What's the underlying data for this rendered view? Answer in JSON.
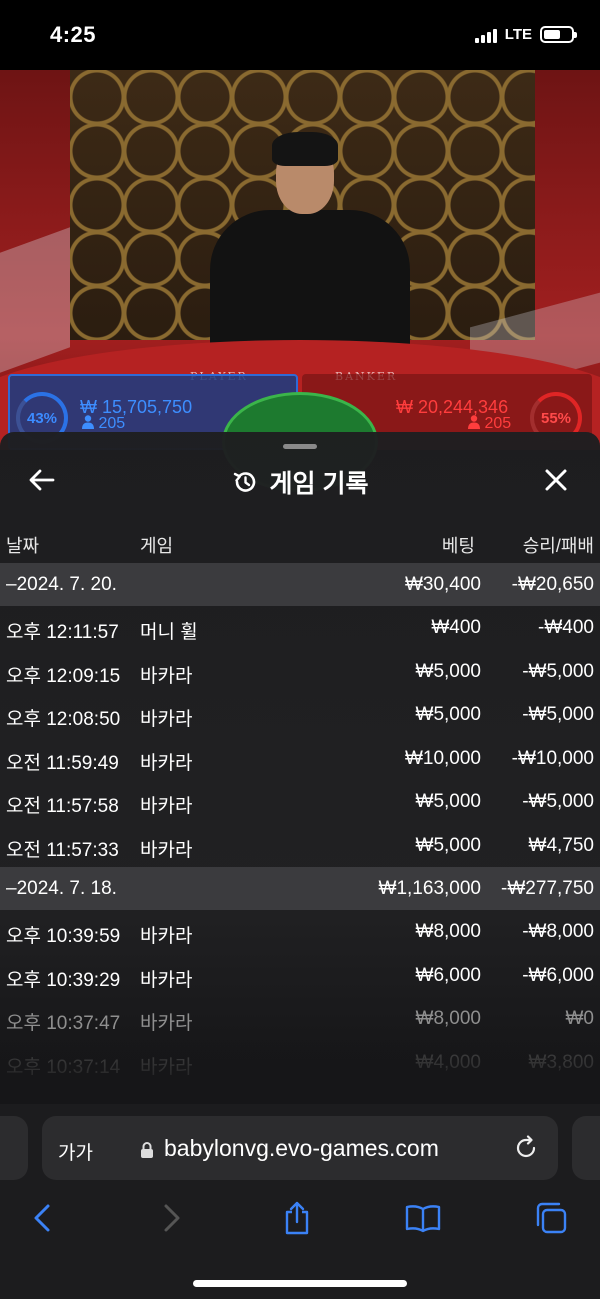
{
  "status_bar": {
    "time": "4:25",
    "network": "LTE"
  },
  "video": {
    "table_labels": [
      "PLAYER",
      "BANKER"
    ],
    "player": {
      "percent": "43%",
      "amount": "₩ 15,705,750",
      "count": "205"
    },
    "banker": {
      "percent": "55%",
      "amount": "₩ 20,244,346",
      "count": "205"
    }
  },
  "sheet": {
    "title": "게임 기록",
    "columns": {
      "date": "날짜",
      "game": "게임",
      "bet": "베팅",
      "result": "승리/패배"
    },
    "rows": [
      {
        "type": "group",
        "date": "–2024. 7. 20.",
        "bet": "₩30,400",
        "result": "-₩20,650"
      },
      {
        "type": "item",
        "date": "오후 12:11:57",
        "game": "머니 휠",
        "bet": "₩400",
        "result": "-₩400"
      },
      {
        "type": "item",
        "date": "오후 12:09:15",
        "game": "바카라",
        "bet": "₩5,000",
        "result": "-₩5,000"
      },
      {
        "type": "item",
        "date": "오후 12:08:50",
        "game": "바카라",
        "bet": "₩5,000",
        "result": "-₩5,000"
      },
      {
        "type": "item",
        "date": "오전 11:59:49",
        "game": "바카라",
        "bet": "₩10,000",
        "result": "-₩10,000"
      },
      {
        "type": "item",
        "date": "오전 11:57:58",
        "game": "바카라",
        "bet": "₩5,000",
        "result": "-₩5,000"
      },
      {
        "type": "item",
        "date": "오전 11:57:33",
        "game": "바카라",
        "bet": "₩5,000",
        "result": "₩4,750"
      },
      {
        "type": "group",
        "date": "–2024. 7. 18.",
        "bet": "₩1,163,000",
        "result": "-₩277,750"
      },
      {
        "type": "item",
        "date": "오후 10:39:59",
        "game": "바카라",
        "bet": "₩8,000",
        "result": "-₩8,000"
      },
      {
        "type": "item",
        "date": "오후 10:39:29",
        "game": "바카라",
        "bet": "₩6,000",
        "result": "-₩6,000"
      },
      {
        "type": "item",
        "date": "오후 10:37:47",
        "game": "바카라",
        "bet": "₩8,000",
        "result": "₩0",
        "style": "dim"
      },
      {
        "type": "item",
        "date": "오후 10:37:14",
        "game": "바카라",
        "bet": "₩4,000",
        "result": "₩3,800",
        "style": "dimmer"
      }
    ]
  },
  "browser": {
    "text_size_label": "가가",
    "url": "babylonvg.evo-games.com"
  },
  "colors": {
    "player_blue": "#3d8eff",
    "banker_red": "#ff3d3d",
    "group_row_bg": "#3b3b3e",
    "ios_blue": "#3b82f6"
  }
}
